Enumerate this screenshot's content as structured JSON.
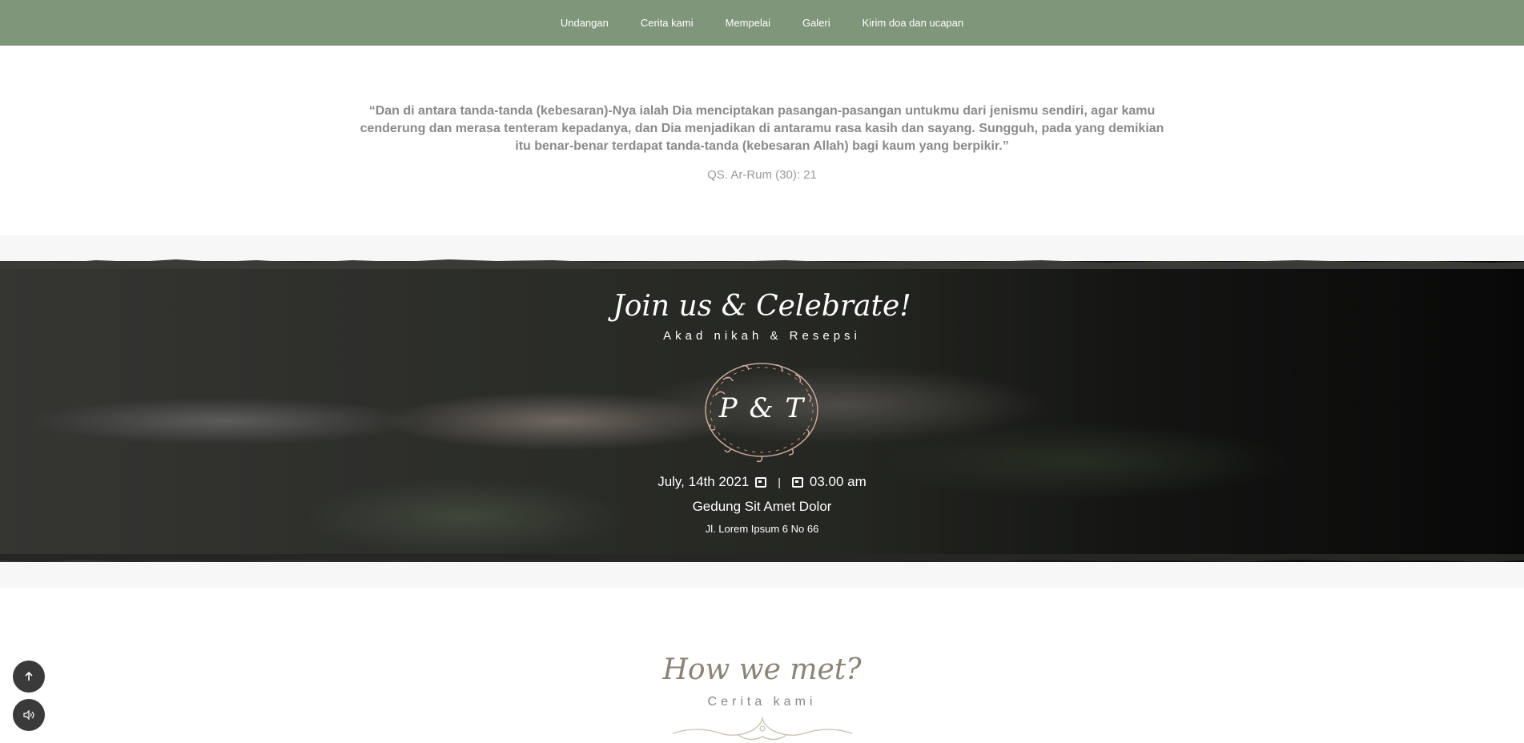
{
  "nav": {
    "items": [
      "Undangan",
      "Cerita kami",
      "Mempelai",
      "Galeri",
      "Kirim doa dan ucapan"
    ]
  },
  "quote": {
    "text": "“Dan di antara tanda-tanda (kebesaran)-Nya ialah Dia menciptakan pasangan-pasangan untukmu dari jenismu sendiri, agar kamu cenderung dan merasa tenteram kepadanya, dan Dia menjadikan di antaramu rasa kasih dan sayang. Sungguh, pada yang demikian itu benar-benar terdapat tanda-tanda (kebesaran Allah) bagi kaum yang berpikir.”",
    "source": "QS. Ar-Rum (30): 21"
  },
  "event": {
    "title": "Join us & Celebrate!",
    "subtitle": "Akad nikah & Resepsi",
    "monogram": "P & T",
    "date": "July, 14th 2021",
    "separator": "|",
    "time": "03.00 am",
    "venue": "Gedung Sit Amet Dolor",
    "address": "Jl. Lorem Ipsum 6 No 66"
  },
  "story": {
    "title": "How we met?",
    "subtitle": "Cerita kami"
  },
  "buttons": {
    "scroll_top_icon": "arrow-up-icon",
    "sound_icon": "speaker-icon"
  },
  "colors": {
    "nav_bg": "#7f967a",
    "quote_text": "#8a8a8a",
    "story_title": "#8b8376",
    "fab_bg": "#3a3a3a"
  }
}
